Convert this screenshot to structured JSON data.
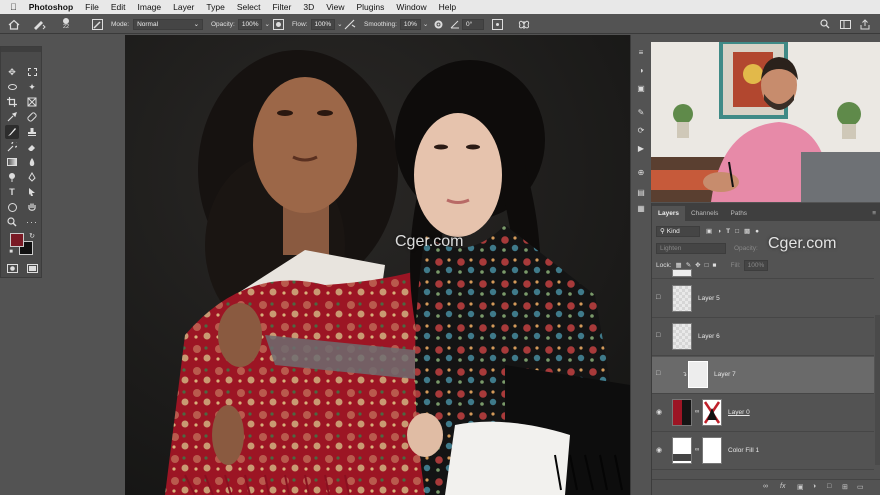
{
  "menubar": {
    "apple": "",
    "app": "Photoshop",
    "items": [
      "File",
      "Edit",
      "Image",
      "Layer",
      "Type",
      "Select",
      "Filter",
      "3D",
      "View",
      "Plugins",
      "Window",
      "Help"
    ]
  },
  "options": {
    "brush_size": "22",
    "mode_label": "Mode:",
    "mode_value": "Normal",
    "opacity_label": "Opacity:",
    "opacity_value": "100%",
    "flow_label": "Flow:",
    "flow_value": "100%",
    "smoothing_label": "Smoothing:",
    "smoothing_value": "10%",
    "angle_value": "0°"
  },
  "watermark": "Cger.com",
  "layers_panel": {
    "tabs": [
      "Layers",
      "Channels",
      "Paths"
    ],
    "filter_kind": "Kind",
    "blend_mode": "Lighten",
    "opacity_label": "Opacity:",
    "lock_label": "Lock:",
    "fill_label": "Fill:",
    "fill_value": "100%",
    "layers": [
      {
        "name": "Layer 5",
        "visible": false
      },
      {
        "name": "Layer 6",
        "visible": false
      },
      {
        "name": "Layer 7",
        "visible": false,
        "selected": true
      },
      {
        "name": "Layer 0",
        "visible": true
      },
      {
        "name": "Color Fill 1",
        "visible": true
      }
    ]
  },
  "colors": {
    "foreground": "#7a1a25",
    "background": "#111111",
    "accent": "#2d8ceb"
  }
}
